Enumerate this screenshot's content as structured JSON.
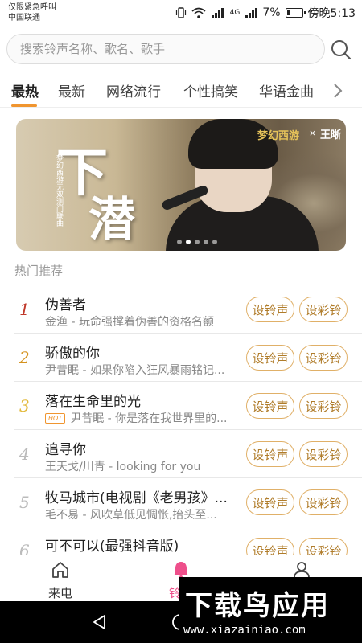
{
  "status_bar": {
    "carrier_line1": "仅限紧急呼叫",
    "carrier_line2": "中国联通",
    "battery": "7%",
    "time": "傍晚5:13",
    "network": "4G"
  },
  "search": {
    "placeholder": "搜索铃声名称、歌名、歌手"
  },
  "tabs": [
    {
      "label": "最热",
      "active": true
    },
    {
      "label": "最新"
    },
    {
      "label": "网络流行"
    },
    {
      "label": "个性搞笑"
    },
    {
      "label": "华语金曲"
    }
  ],
  "banner": {
    "title_char1": "下",
    "title_char2": "潜",
    "subtitle": "梦幻西游无双测门联曲",
    "logo1": "梦幻西游",
    "logo_x": "×",
    "logo2": "王晰"
  },
  "section": {
    "title": "热门推荐"
  },
  "colors": {
    "accent": "#f0952f",
    "button_text": "#b07c2a",
    "nav_active": "#ee4f8b",
    "rank1": "#c0392b",
    "rank2": "#d4921f",
    "rank3": "#e2b93b",
    "rank_other": "#bbbbbb"
  },
  "songs": [
    {
      "rank": "1",
      "title": "伪善者",
      "meta": "金渔 - 玩命强撑着伪善的资格名额",
      "hot": false
    },
    {
      "rank": "2",
      "title": "骄傲的你",
      "meta": "尹昔眠 - 如果你陷入狂风暴雨铭记...",
      "hot": false
    },
    {
      "rank": "3",
      "title": "落在生命里的光",
      "meta": "尹昔眠 - 你是落在我世界里的...",
      "hot": true,
      "hot_label": "HOT"
    },
    {
      "rank": "4",
      "title": "追寻你",
      "meta": "王天戈/川青 - looking for you",
      "hot": false
    },
    {
      "rank": "5",
      "title": "牧马城市(电视剧《老男孩》...",
      "meta": "毛不易 - 风吹草低见惆怅,抬头至...",
      "hot": false
    },
    {
      "rank": "6",
      "title": "可不可以(最强抖音版)",
      "meta": "",
      "hot": false
    }
  ],
  "buttons": {
    "set_ringtone": "设铃声",
    "set_crbt": "设彩铃"
  },
  "bottom_nav": [
    {
      "label": "来电",
      "icon": "home-icon"
    },
    {
      "label": "铃声",
      "icon": "bell-icon",
      "active": true
    },
    {
      "label": "我的",
      "icon": "user-icon"
    }
  ],
  "watermark": {
    "brand": "下载鸟应用",
    "url": "www.xiazainiao.com"
  }
}
